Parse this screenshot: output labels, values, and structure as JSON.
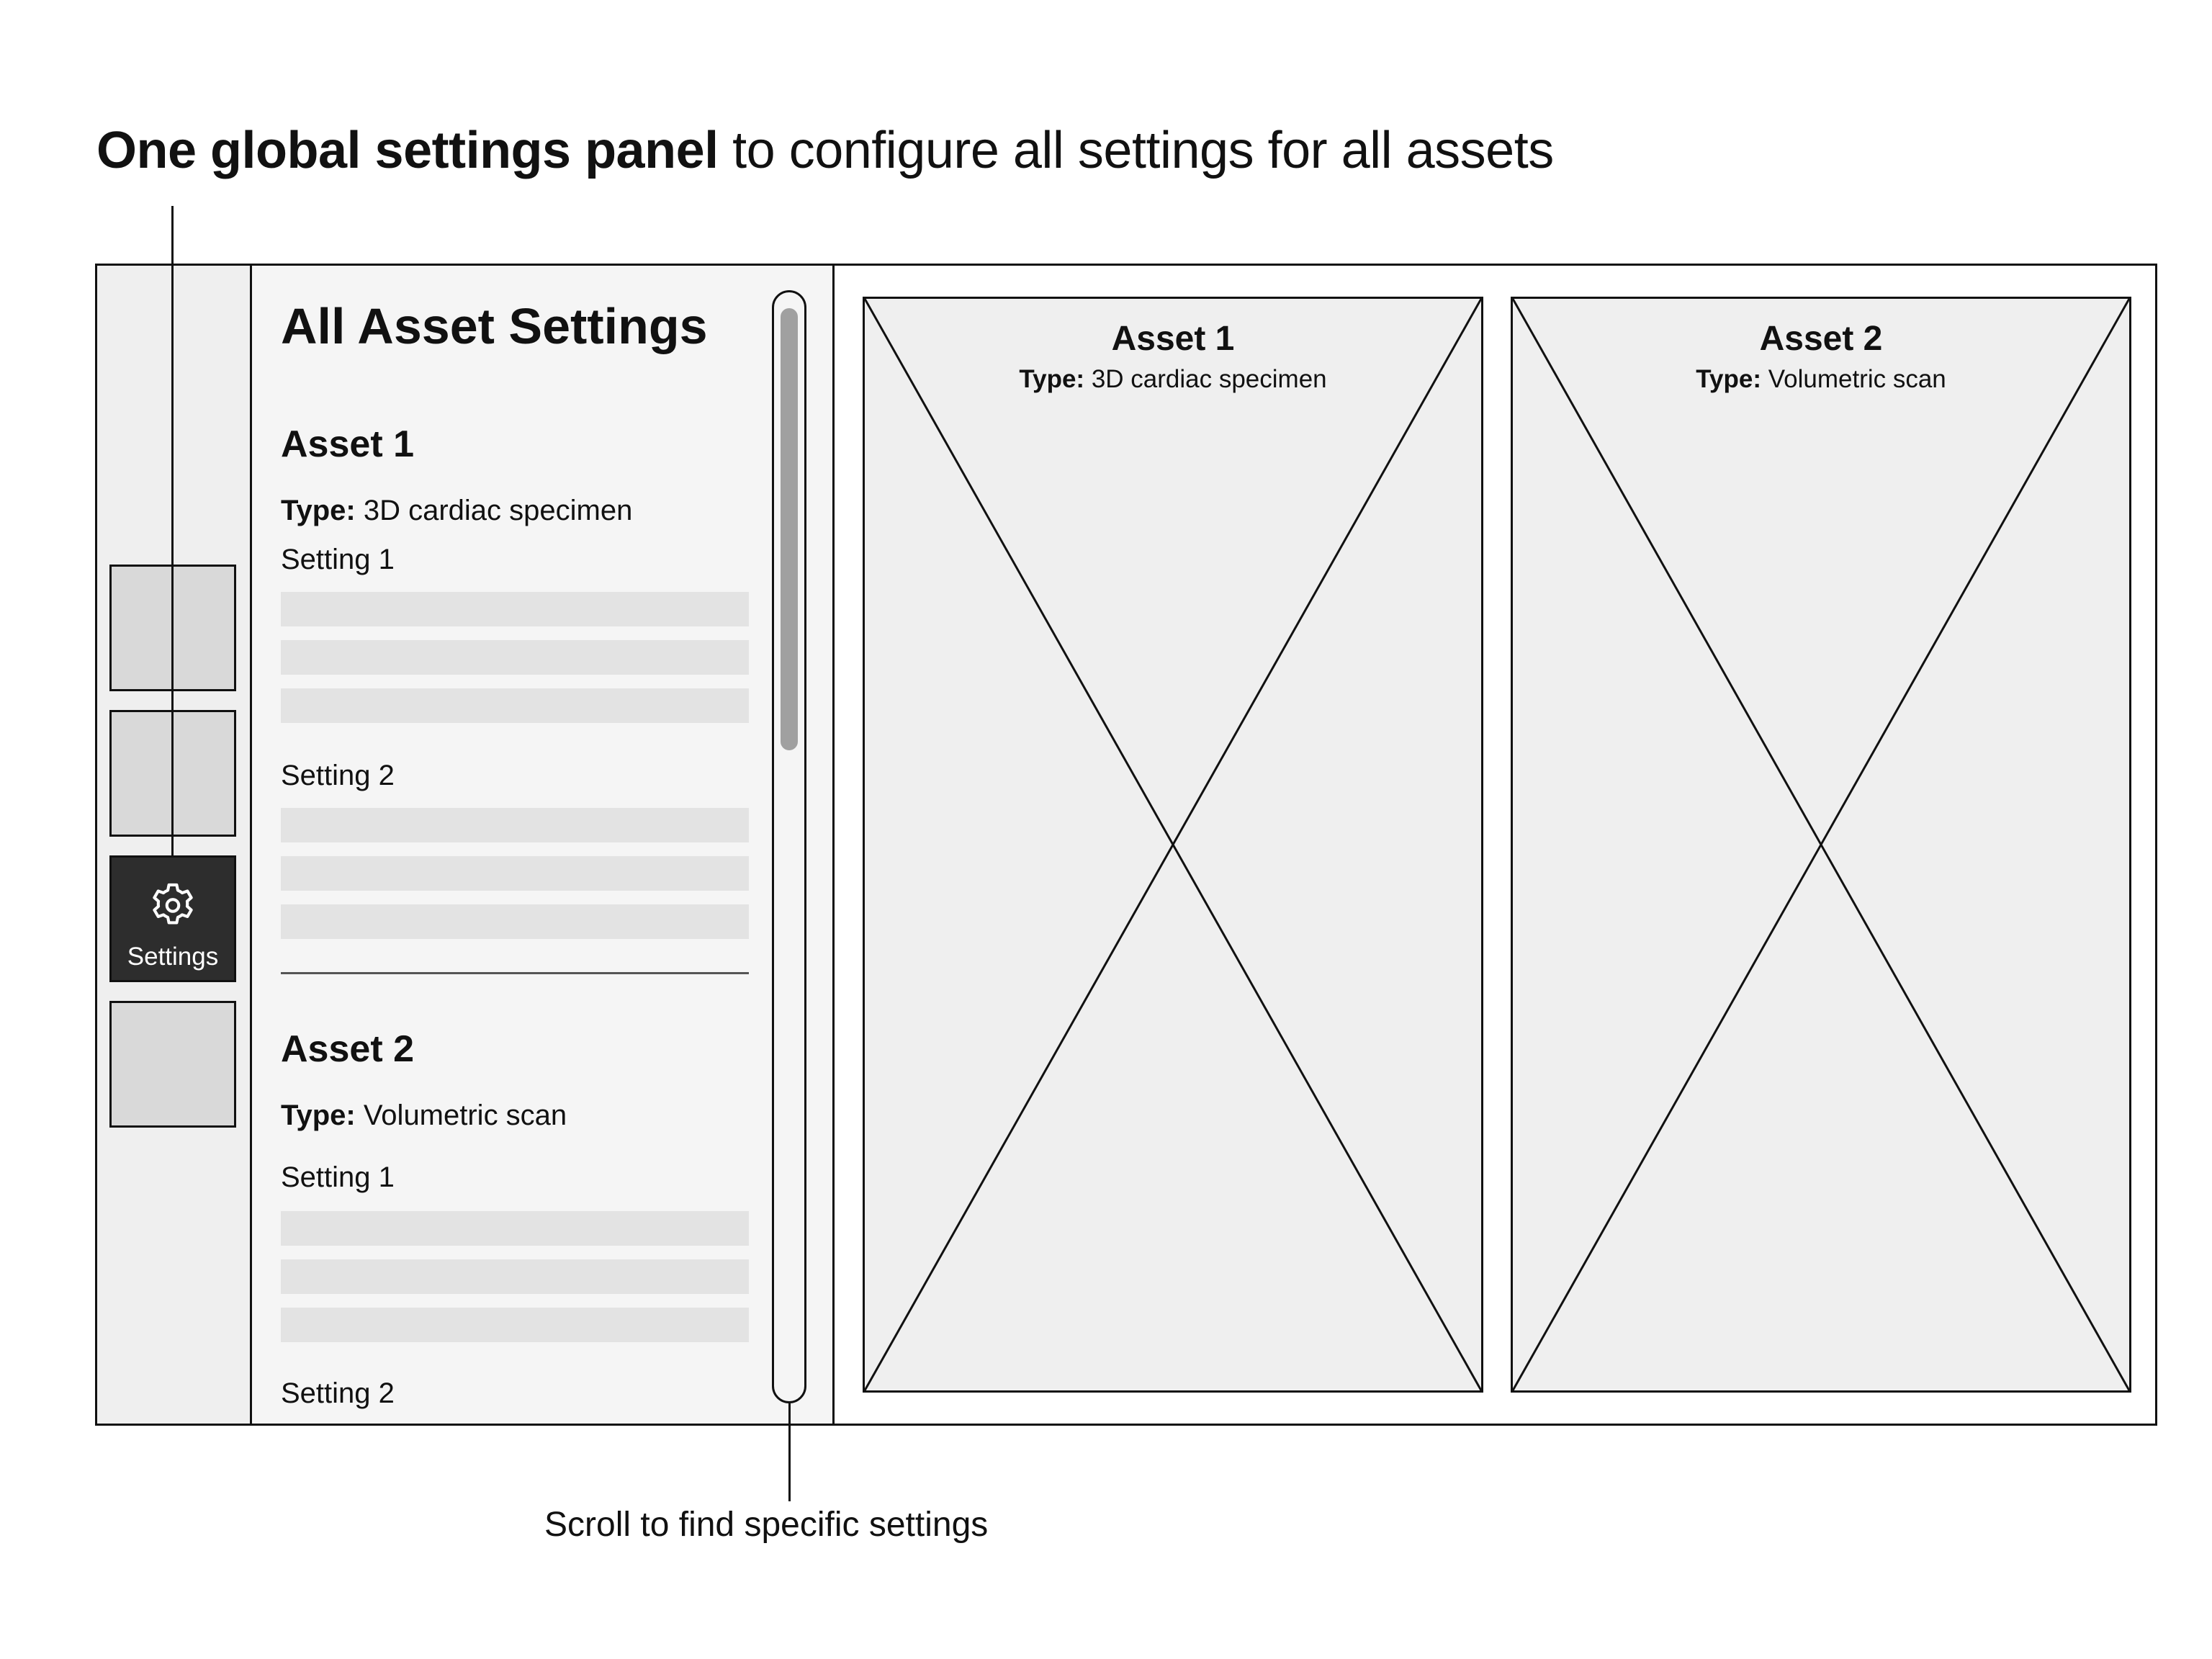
{
  "headline": {
    "bold": "One global settings panel",
    "rest": " to configure all settings for all assets"
  },
  "rail": {
    "active_label": "Settings",
    "active_icon": "gear-icon"
  },
  "panel": {
    "title": "All Asset Settings",
    "type_prefix": "Type:",
    "assets": [
      {
        "heading": "Asset 1",
        "type": " 3D cardiac specimen",
        "settings": [
          "Setting 1",
          "Setting 2"
        ]
      },
      {
        "heading": "Asset 2",
        "type": " Volumetric scan",
        "settings": [
          "Setting 1",
          "Setting 2"
        ]
      }
    ]
  },
  "cards": [
    {
      "title": "Asset 1",
      "type_prefix": "Type:",
      "type": " 3D cardiac specimen"
    },
    {
      "title": "Asset 2",
      "type_prefix": "Type:",
      "type": " Volumetric scan"
    }
  ],
  "caption": "Scroll to find specific settings",
  "colors": {
    "rail_bg": "#efefef",
    "active_tile": "#2d2d2d",
    "panel_bg": "#f5f5f5",
    "field": "#e3e3e3",
    "scroll_thumb": "#a0a0a0"
  }
}
